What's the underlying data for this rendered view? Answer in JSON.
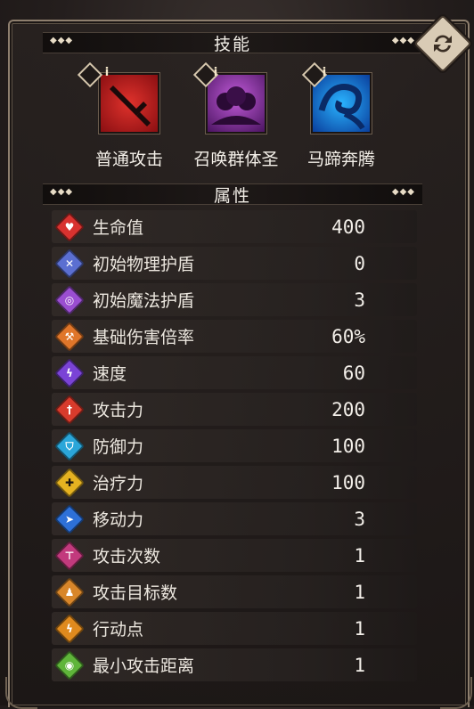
{
  "sections": {
    "skills_title": "技能",
    "attributes_title": "属性"
  },
  "skills": [
    {
      "name": "普通攻击",
      "icon": "sword-icon",
      "color": "#c0191b"
    },
    {
      "name": "召唤群体圣",
      "icon": "summon-icon",
      "color": "#8a2c9e"
    },
    {
      "name": "马蹄奔腾",
      "icon": "hoof-icon",
      "color": "#1e7be0"
    }
  ],
  "stats": [
    {
      "label": "生命值",
      "value": "400",
      "icon": "heart-icon",
      "color": "#d8322f"
    },
    {
      "label": "初始物理护盾",
      "value": "0",
      "icon": "physical-shield-icon",
      "color": "#5b6fd1"
    },
    {
      "label": "初始魔法护盾",
      "value": "3",
      "icon": "magic-shield-icon",
      "color": "#9a4ed1"
    },
    {
      "label": "基础伤害倍率",
      "value": "60%",
      "icon": "damage-multiplier-icon",
      "color": "#e0762a"
    },
    {
      "label": "速度",
      "value": "60",
      "icon": "speed-icon",
      "color": "#7a43d6"
    },
    {
      "label": "攻击力",
      "value": "200",
      "icon": "attack-icon",
      "color": "#d83b2c"
    },
    {
      "label": "防御力",
      "value": "100",
      "icon": "defense-icon",
      "color": "#2ba6d9"
    },
    {
      "label": "治疗力",
      "value": "100",
      "icon": "heal-icon",
      "color": "#e5b221"
    },
    {
      "label": "移动力",
      "value": "3",
      "icon": "move-icon",
      "color": "#2d70d8"
    },
    {
      "label": "攻击次数",
      "value": "1",
      "icon": "attack-count-icon",
      "color": "#c23a7d"
    },
    {
      "label": "攻击目标数",
      "value": "1",
      "icon": "target-count-icon",
      "color": "#d8862a"
    },
    {
      "label": "行动点",
      "value": "1",
      "icon": "action-point-icon",
      "color": "#df8a1e"
    },
    {
      "label": "最小攻击距离",
      "value": "1",
      "icon": "min-range-icon",
      "color": "#5fb53a"
    }
  ]
}
